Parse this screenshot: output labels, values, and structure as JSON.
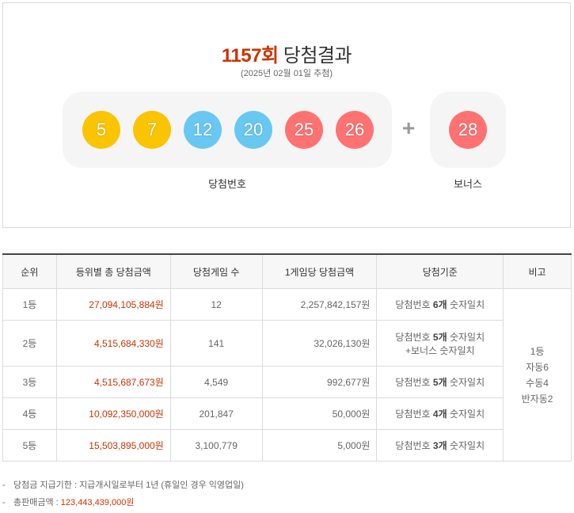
{
  "header": {
    "round": "1157회",
    "title_suffix": "당첨결과",
    "draw_date": "(2025년 02월 01일 추첨)"
  },
  "numbers": {
    "main": [
      {
        "value": "5",
        "color": "#fbc400"
      },
      {
        "value": "7",
        "color": "#fbc400"
      },
      {
        "value": "12",
        "color": "#69c8f2"
      },
      {
        "value": "20",
        "color": "#69c8f2"
      },
      {
        "value": "25",
        "color": "#ff7272"
      },
      {
        "value": "26",
        "color": "#ff7272"
      }
    ],
    "plus": "+",
    "bonus": {
      "value": "28",
      "color": "#ff7272"
    },
    "main_label": "당첨번호",
    "bonus_label": "보너스"
  },
  "table": {
    "headers": [
      "순위",
      "등위별 총 당첨금액",
      "당첨게임 수",
      "1게임당 당첨금액",
      "당첨기준",
      "비고"
    ],
    "rows": [
      {
        "rank": "1등",
        "total": "27,094,105,884원",
        "games": "12",
        "per_game": "2,257,842,157원",
        "crit_pre": "당첨번호 ",
        "crit_bold": "6개",
        "crit_post": " 숫자일치",
        "crit_line2": ""
      },
      {
        "rank": "2등",
        "total": "4,515,684,330원",
        "games": "141",
        "per_game": "32,026,130원",
        "crit_pre": "당첨번호 ",
        "crit_bold": "5개",
        "crit_post": " 숫자일치",
        "crit_line2": "+보너스 숫자일치"
      },
      {
        "rank": "3등",
        "total": "4,515,687,673원",
        "games": "4,549",
        "per_game": "992,677원",
        "crit_pre": "당첨번호 ",
        "crit_bold": "5개",
        "crit_post": " 숫자일치",
        "crit_line2": ""
      },
      {
        "rank": "4등",
        "total": "10,092,350,000원",
        "games": "201,847",
        "per_game": "50,000원",
        "crit_pre": "당첨번호 ",
        "crit_bold": "4개",
        "crit_post": " 숫자일치",
        "crit_line2": ""
      },
      {
        "rank": "5등",
        "total": "15,503,895,000원",
        "games": "3,100,779",
        "per_game": "5,000원",
        "crit_pre": "당첨번호 ",
        "crit_bold": "3개",
        "crit_post": " 숫자일치",
        "crit_line2": ""
      }
    ],
    "note": [
      "1등",
      "자동6",
      "수동4",
      "반자동2"
    ]
  },
  "footnotes": {
    "dash": "-",
    "payment_deadline": "당첨금 지급기한 : 지급개시일로부터 1년 (휴일인 경우 익영업일)",
    "total_sales_label": "총판매금액 : ",
    "total_sales_value": "123,443,439,000원"
  }
}
